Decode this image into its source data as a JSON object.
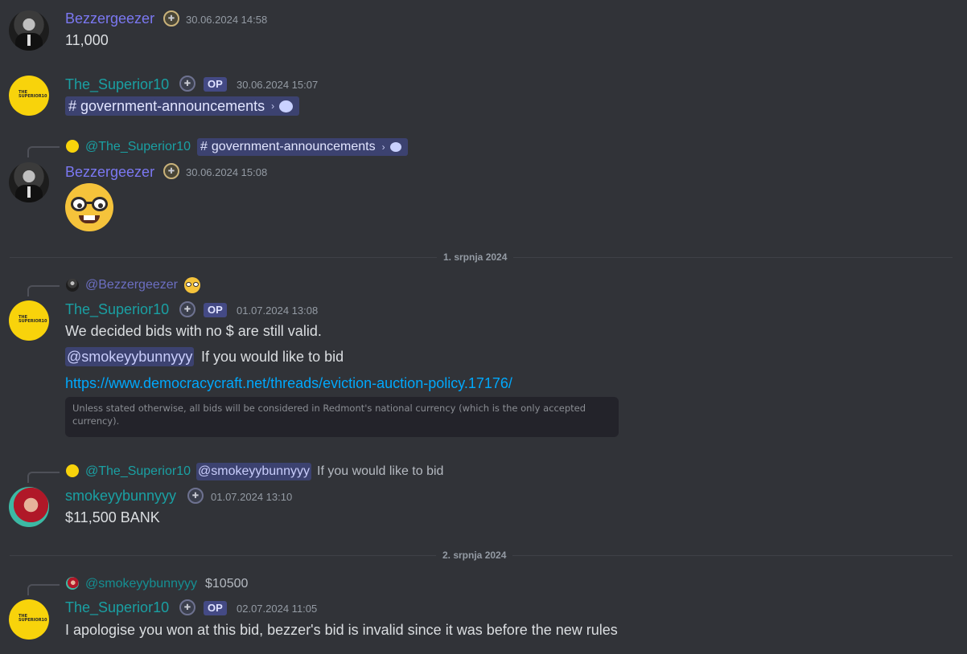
{
  "messages": [
    {
      "author": "Bezzergeezer",
      "timestamp": "30.06.2024 14:58",
      "text": "11,000"
    },
    {
      "author": "The_Superior10",
      "op": "OP",
      "timestamp": "30.06.2024 15:07",
      "channel": "government-announcements"
    },
    {
      "reply_to": "@The_Superior10",
      "reply_channel": "government-announcements",
      "author": "Bezzergeezer",
      "timestamp": "30.06.2024 15:08",
      "emoji": "nerd-face"
    },
    {
      "reply_to": "@Bezzergeezer",
      "reply_emoji": "nerd-face",
      "author": "The_Superior10",
      "op": "OP",
      "timestamp": "01.07.2024 13:08",
      "line1": "We decided bids with no $ are still valid.",
      "mention": "@smokeyybunnyyy",
      "line2": " If you would like to bid",
      "link": "https://www.democracycraft.net/threads/eviction-auction-policy.17176/",
      "embed_text": "Unless stated otherwise, all bids will be considered in Redmont's national currency (which is the only accepted currency)."
    },
    {
      "reply_to": "@The_Superior10",
      "reply_mention": "@smokeyybunnyyy",
      "reply_text": " If you would like to bid",
      "author": "smokeyybunnyyy",
      "timestamp": "01.07.2024 13:10",
      "text": "$11,500 BANK"
    },
    {
      "reply_to": "@smokeyybunnyyy",
      "reply_text": "$10500",
      "author": "The_Superior10",
      "op": "OP",
      "timestamp": "02.07.2024 11:05",
      "text": "I apologise you won at this bid, bezzer's  bid is invalid since it was before the new rules"
    }
  ],
  "dividers": [
    "1. srpnja 2024",
    "2. srpnja 2024"
  ],
  "avatar_text": "THE SUPERIOR10",
  "colors": {
    "bezz": "#7b78f2",
    "superior": "#1aa0a3",
    "background": "#313338",
    "link": "#00a8fc"
  }
}
